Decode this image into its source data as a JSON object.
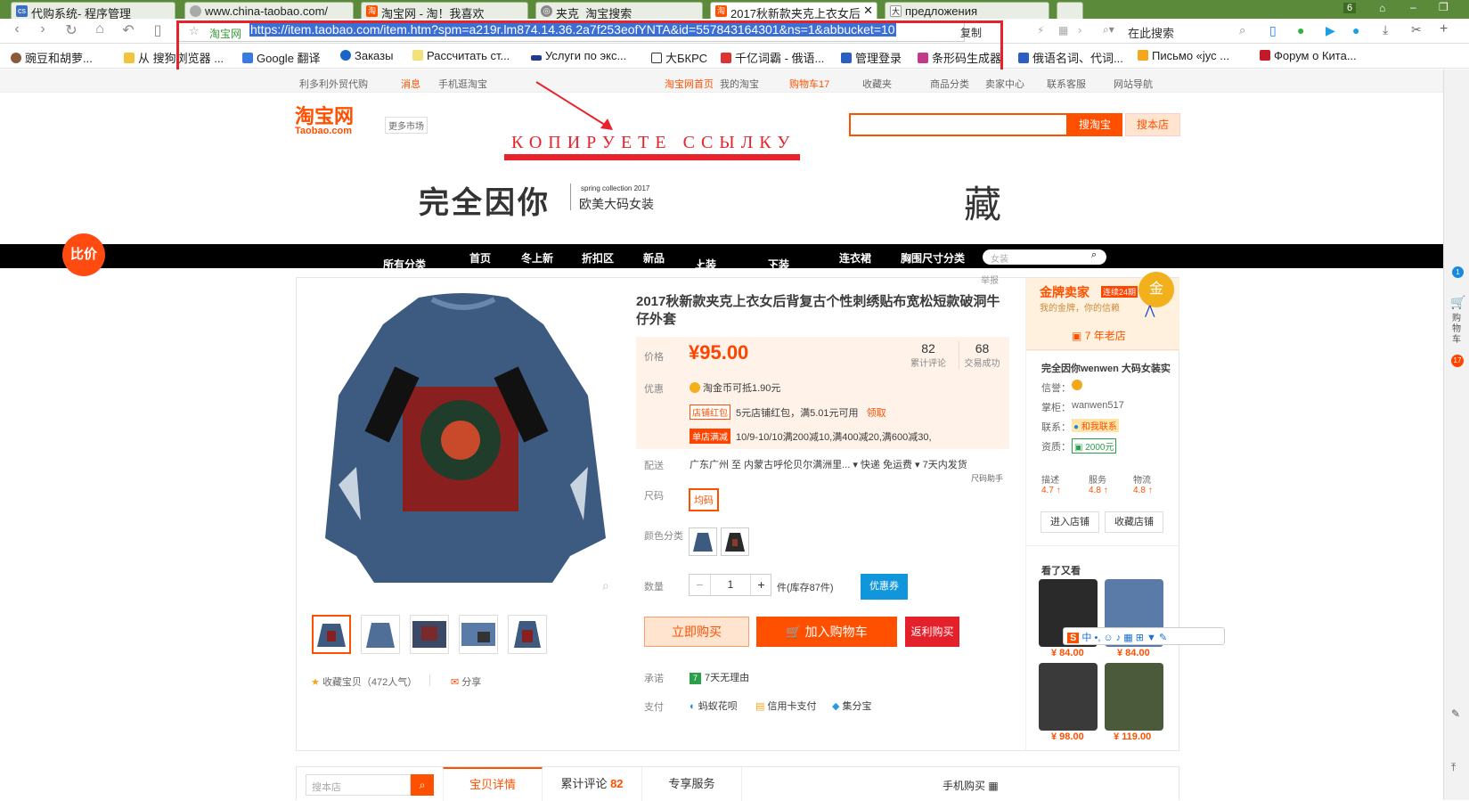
{
  "browser": {
    "tabs": [
      {
        "label": "代购系统- 程序管理",
        "icon": "cs-icon"
      },
      {
        "label": "www.china-taobao.com/",
        "icon": "loading-icon"
      },
      {
        "label": "淘宝网 - 淘！我喜欢",
        "icon": "taobao-icon"
      },
      {
        "label": "夹克_淘宝搜索",
        "icon": "globe-icon"
      },
      {
        "label": "2017秋新款夹克上衣女后",
        "icon": "taobao-icon"
      },
      {
        "label": "предложения",
        "icon": "dictionary-icon"
      }
    ],
    "tab_count": "6",
    "url_site": "淘宝网",
    "url": "https://item.taobao.com/item.htm?spm=a219r.lm874.14.36.2a7f253eofYNTA&id=557843164301&ns=1&abbucket=10",
    "copy_label": "复制",
    "search_placeholder": "在此搜索",
    "bookmarks": [
      "豌豆和胡萝...",
      "从 搜狗浏览器 ...",
      "Google 翻译",
      "Заказы",
      "Рассчитать ст...",
      "Услуги по экс...",
      "大БКРС",
      "千亿词霸 - 俄语...",
      "管理登录",
      "条形码生成器",
      "俄语名词、代词...",
      "Письмо «јус ...",
      "Форум о Кита..."
    ]
  },
  "sitebar": [
    "利多利外贸代购",
    "消息",
    "手机逛淘宝",
    "淘宝网首页",
    "我的淘宝",
    "购物车17",
    "收藏夹",
    "商品分类",
    "卖家中心",
    "联系客服",
    "网站导航"
  ],
  "header": {
    "logo_cn": "淘宝网",
    "logo_en": "Taobao.com",
    "more_market": "更多市场",
    "search_btn": "搜淘宝",
    "shop_search_btn": "搜本店",
    "annotation": "КОПИРУЕТЕ ССЫЛКУ",
    "shop_name": "完全因你",
    "shop_sub1": "spring collection 2017",
    "shop_sub2": "欧美大码女装",
    "collect_char": "藏",
    "compare": "比价"
  },
  "nav": {
    "items": [
      "所有分类",
      "首页",
      "冬上新",
      "折扣区",
      "新品",
      "上装",
      "下装",
      "连衣裙",
      "胸围尺寸分类"
    ],
    "search_placeholder": "女装"
  },
  "product": {
    "title": "2017秋新款夹克上衣女后背复古个性刺绣贴布宽松短款破洞牛仔外套",
    "report": "举报",
    "price_label": "价格",
    "price": "¥95.00",
    "reviews_count": "82",
    "reviews_label": "累计评论",
    "deals_count": "68",
    "deals_label": "交易成功",
    "promo_label": "优惠",
    "promo1": "淘金币可抵1.90元",
    "promo2_tag": "店铺红包",
    "promo2": "5元店铺红包，满5.01元可用",
    "promo2_link": "领取",
    "promo3_tag": "单店满减",
    "promo3": "10/9-10/10满200减10,满400减20,满600减30,",
    "delivery_label": "配送",
    "delivery": "广东广州 至  内蒙古呼伦贝尔满洲里...  ▾   快递 免运费  ▾   7天内发货",
    "size_helper": "尺码助手",
    "size_label": "尺码",
    "size_value": "均码",
    "color_label": "颜色分类",
    "qty_label": "数量",
    "qty_value": "1",
    "stock": "件(库存87件)",
    "coupon": "优惠券",
    "buy_now": "立即购买",
    "add_cart": "加入购物车",
    "rebate": "返利购买",
    "promise_label": "承诺",
    "promise": "7天无理由",
    "pay_label": "支付",
    "pay1": "蚂蚁花呗",
    "pay2": "信用卡支付",
    "pay3": "集分宝",
    "favorite": "收藏宝贝（472人气）",
    "share": "分享"
  },
  "seller": {
    "gold_title": "金牌卖家",
    "gold_badge": "连续24期",
    "gold_sub": "我的金牌，你的信赖",
    "gold_medal": "金",
    "years": "7 年老店",
    "shop_full": "完全因你wenwen 大码女装实",
    "credit_label": "信誉：",
    "keeper_label": "掌柜：",
    "keeper": "wanwen517",
    "contact_label": "联系：",
    "contact": "和我联系",
    "qual_label": "资质：",
    "qual": "2000元",
    "scores": [
      {
        "name": "描述",
        "value": "4.7"
      },
      {
        "name": "服务",
        "value": "4.8"
      },
      {
        "name": "物流",
        "value": "4.8"
      }
    ],
    "enter_shop": "进入店铺",
    "fav_shop": "收藏店铺",
    "seen_title": "看了又看",
    "related": [
      "¥ 84.00",
      "¥ 84.00",
      "¥ 98.00",
      "¥ 119.00"
    ]
  },
  "bottom": {
    "search_placeholder": "搜本店",
    "tabs": [
      "宝贝详情",
      "累计评论",
      "专享服务"
    ],
    "review_count": "82",
    "mobile_buy": "手机购买"
  },
  "sidestrip": {
    "cart_label": "购物车",
    "cart_count": "17",
    "msg_count": "1"
  },
  "ime": {
    "label": "中"
  },
  "colors": {
    "brand": "#ff5000",
    "annot": "#e8222a",
    "tabbar": "#5b8a3a"
  }
}
